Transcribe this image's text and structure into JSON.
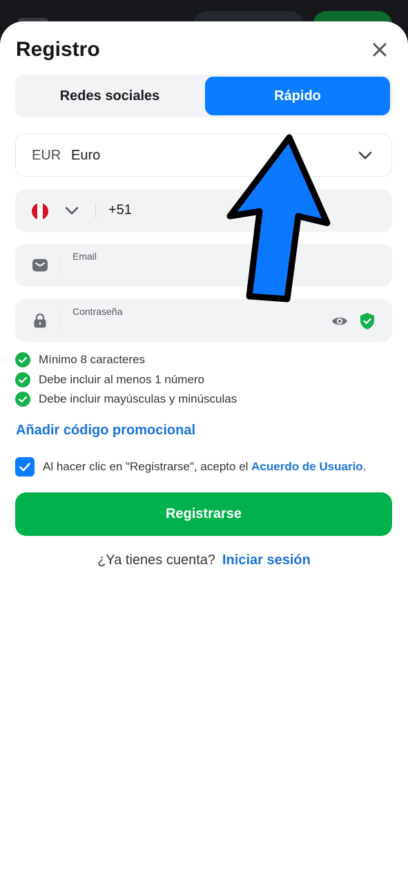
{
  "colors": {
    "accent": "#0a7cff",
    "link": "#1a73d9",
    "success": "#00b14c",
    "check": "#13b04b"
  },
  "dialog": {
    "title": "Registro"
  },
  "tabs": [
    {
      "label": "Redes sociales",
      "active": false
    },
    {
      "label": "Rápido",
      "active": true
    }
  ],
  "currency": {
    "code": "EUR",
    "name": "Euro"
  },
  "phone": {
    "country_flag": "peru-flag",
    "prefix": "+51"
  },
  "email": {
    "label": "Email",
    "value": ""
  },
  "password": {
    "label": "Contraseña",
    "value": ""
  },
  "rules": [
    "Mínimo 8 caracteres",
    "Debe incluir al menos 1 número",
    "Debe incluir mayúsculas y minúsculas"
  ],
  "promo": {
    "label": "Añadir código promocional"
  },
  "agreement": {
    "checked": true,
    "text": "Al hacer clic en \"Registrarse\", acepto el ",
    "link": "Acuerdo de Usuario",
    "suffix": "."
  },
  "register_button": {
    "label": "Registrarse"
  },
  "login": {
    "prompt": "¿Ya tienes cuenta?",
    "link": "Iniciar sesión"
  }
}
